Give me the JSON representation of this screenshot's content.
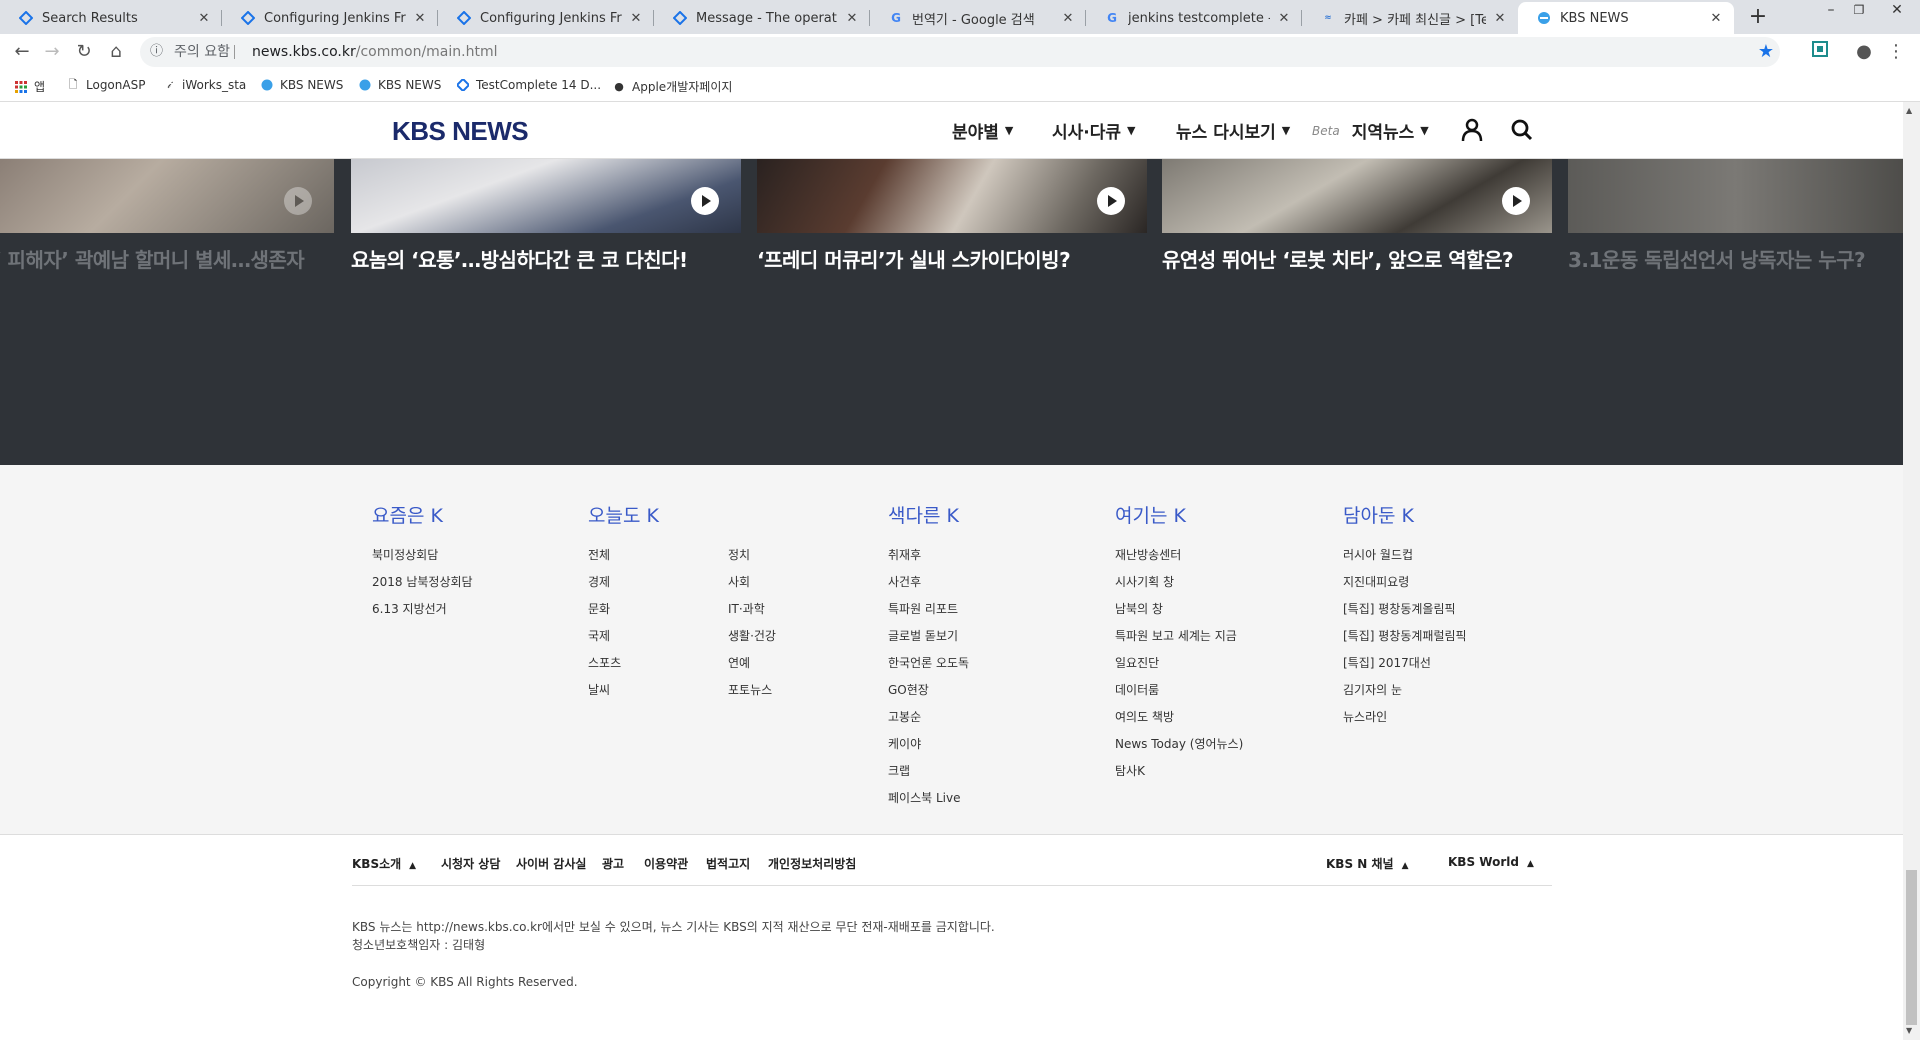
{
  "browser": {
    "tabs": [
      {
        "title": "Search Results",
        "icon": "diamond-icon",
        "color": "#1a73e8"
      },
      {
        "title": "Configuring Jenkins Freesty",
        "icon": "diamond-icon",
        "color": "#1a73e8"
      },
      {
        "title": "Configuring Jenkins Freesty",
        "icon": "diamond-icon",
        "color": "#1a73e8"
      },
      {
        "title": "Message - The operation ca",
        "icon": "diamond-icon",
        "color": "#1a73e8"
      },
      {
        "title": "번역기 - Google 검색",
        "icon": "google-icon",
        "color": "#4285f4"
      },
      {
        "title": "jenkins testcomplete - Goo",
        "icon": "google-icon",
        "color": "#4285f4"
      },
      {
        "title": "카페 > 카페 최신글 > [Test",
        "icon": "cafe-icon",
        "color": "#3a7bd5"
      },
      {
        "title": "KBS NEWS",
        "icon": "kbs-icon",
        "color": "#3aa0e8"
      }
    ],
    "security_label": "주의 요함",
    "url_host": "news.kbs.co.kr",
    "url_path": "/common/main.html",
    "bookmarks": [
      {
        "label": "앱",
        "icon": "apps-icon"
      },
      {
        "label": "LogonASP",
        "icon": "page-icon"
      },
      {
        "label": "iWorks_sta",
        "icon": "iworks-icon"
      },
      {
        "label": "KBS NEWS",
        "icon": "kbs-icon"
      },
      {
        "label": "KBS NEWS",
        "icon": "kbs-icon"
      },
      {
        "label": "TestComplete 14 D...",
        "icon": "diamond-icon"
      },
      {
        "label": "Apple개발자페이지",
        "icon": "apple-icon"
      }
    ]
  },
  "header": {
    "logo": "KBS NEWS",
    "nav": [
      {
        "label": "분야별"
      },
      {
        "label": "시사·다큐"
      },
      {
        "label": "뉴스 다시보기"
      },
      {
        "label": "지역뉴스",
        "badge": "Beta"
      }
    ]
  },
  "carousel": {
    "items": [
      {
        "title": "‘ 피해자’ 곽예남 할머니 별세…생존자",
        "dim": true
      },
      {
        "title": "요놈의 ‘요통’…방심하다간 큰 코 다친다!",
        "dim": false
      },
      {
        "title": "‘프레디 머큐리’가 실내 스카이다이빙?",
        "dim": false
      },
      {
        "title": "유연성 뛰어난 ‘로봇 치타’, 앞으로 역할은?",
        "dim": false
      },
      {
        "title": "3.1운동 독립선언서 낭독자는 누구?",
        "dim": true
      }
    ]
  },
  "footer": {
    "columns": [
      {
        "title": "요즘은 K",
        "items": [
          "북미정상회담",
          "2018 남북정상회담",
          "6.13 지방선거"
        ]
      },
      {
        "title": "오늘도 K",
        "items": [
          "전체",
          "경제",
          "문화",
          "국제",
          "스포츠",
          "날씨"
        ],
        "items2": [
          "정치",
          "사회",
          "IT·과학",
          "생활·건강",
          "연예",
          "포토뉴스"
        ]
      },
      {
        "title": "색다른 K",
        "items": [
          "취재후",
          "사건후",
          "특파원 리포트",
          "글로벌 돋보기",
          "한국언론 오도독",
          "GO현장",
          "고봉순",
          "케이야",
          "크랩",
          "페이스북 Live"
        ]
      },
      {
        "title": "여기는 K",
        "items": [
          "재난방송센터",
          "시사기획 창",
          "남북의 창",
          "특파원 보고 세계는 지금",
          "일요진단",
          "데이터룸",
          "여의도 책방",
          "News Today (영어뉴스)",
          "탐사K"
        ]
      },
      {
        "title": "담아둔 K",
        "items": [
          "러시아 월드컵",
          "지진대피요령",
          "[특집] 평창동계올림픽",
          "[특집] 평창동계패럴림픽",
          "[특집] 2017대선",
          "김기자의 눈",
          "뉴스라인"
        ]
      }
    ],
    "bottom_nav": [
      "KBS소개",
      "시청자 상담",
      "사이버 감사실",
      "광고",
      "이용약관",
      "법적고지",
      "개인정보처리방침"
    ],
    "bottom_right": [
      "KBS N 채널",
      "KBS World"
    ],
    "notice": "KBS 뉴스는 http://news.kbs.co.kr에서만 보실 수 있으며, 뉴스 기사는 KBS의 지적 재산으로 무단 전재-재배포를 금지합니다.",
    "youth_officer": "청소년보호책임자 : 김태형",
    "copyright": "Copyright © KBS All Rights Reserved."
  }
}
